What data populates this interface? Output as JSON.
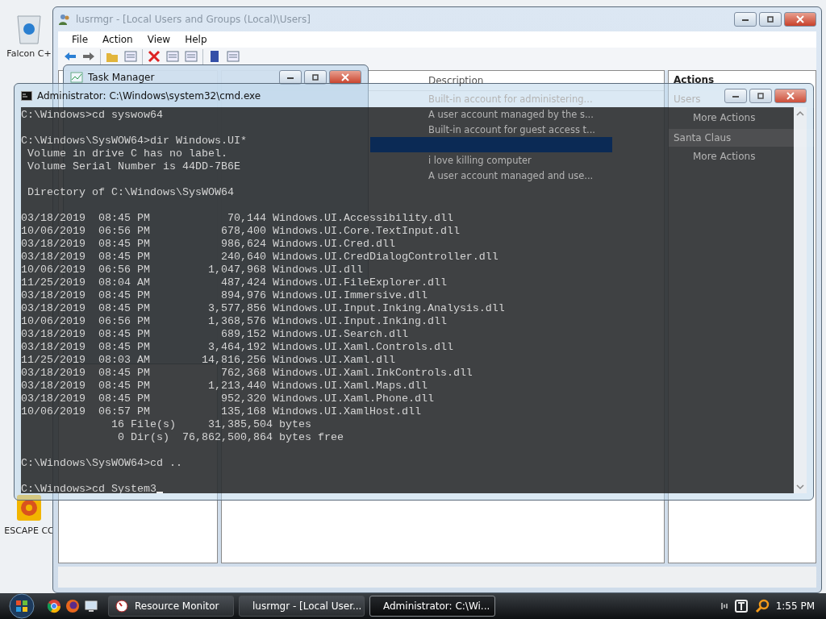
{
  "desktop_icons": [
    {
      "label": "Falcon C+"
    },
    {
      "label": "ESCAPE CC"
    }
  ],
  "lusrmgr": {
    "title": "lusrmgr - [Local Users and Groups (Local)\\Users]",
    "menu": [
      "File",
      "Action",
      "View",
      "Help"
    ],
    "description_header": "Description",
    "rows": [
      {
        "description": "Built-in account for administering...",
        "selected": false
      },
      {
        "description": "A user account managed by the s...",
        "selected": false
      },
      {
        "description": "Built-in account for guest access t...",
        "selected": false
      },
      {
        "selected": true
      },
      {
        "description": "i love killing computer",
        "selected": false
      },
      {
        "description": "A user account managed and use...",
        "selected": false
      }
    ],
    "actions_header": "Actions",
    "action_groups": [
      {
        "title": "Users",
        "items": [
          "More Actions"
        ]
      },
      {
        "title": "Santa Claus",
        "items": [
          "More Actions"
        ]
      }
    ]
  },
  "task_manager": {
    "title": "Task Manager"
  },
  "cmd": {
    "title": "Administrator: C:\\Windows\\system32\\cmd.exe",
    "blocks": [
      [
        "C:\\Windows>cd syswow64"
      ],
      [
        "C:\\Windows\\SysWOW64>dir Windows.UI*",
        " Volume in drive C has no label.",
        " Volume Serial Number is 44DD-7B6E"
      ],
      [
        " Directory of C:\\Windows\\SysWOW64"
      ],
      [
        "03/18/2019  08:45 PM            70,144 Windows.UI.Accessibility.dll",
        "10/06/2019  06:56 PM           678,400 Windows.UI.Core.TextInput.dll",
        "03/18/2019  08:45 PM           986,624 Windows.UI.Cred.dll",
        "03/18/2019  08:45 PM           240,640 Windows.UI.CredDialogController.dll",
        "10/06/2019  06:56 PM         1,047,968 Windows.UI.dll",
        "11/25/2019  08:04 AM           487,424 Windows.UI.FileExplorer.dll",
        "03/18/2019  08:45 PM           894,976 Windows.UI.Immersive.dll",
        "03/18/2019  08:45 PM         3,577,856 Windows.UI.Input.Inking.Analysis.dll",
        "10/06/2019  06:56 PM         1,368,576 Windows.UI.Input.Inking.dll",
        "03/18/2019  08:45 PM           689,152 Windows.UI.Search.dll",
        "03/18/2019  08:45 PM         3,464,192 Windows.UI.Xaml.Controls.dll",
        "11/25/2019  08:03 AM        14,816,256 Windows.UI.Xaml.dll",
        "03/18/2019  08:45 PM           762,368 Windows.UI.Xaml.InkControls.dll",
        "03/18/2019  08:45 PM         1,213,440 Windows.UI.Xaml.Maps.dll",
        "03/18/2019  08:45 PM           952,320 Windows.UI.Xaml.Phone.dll",
        "10/06/2019  06:57 PM           135,168 Windows.UI.XamlHost.dll",
        "              16 File(s)     31,385,504 bytes",
        "               0 Dir(s)  76,862,500,864 bytes free"
      ],
      [
        "C:\\Windows\\SysWOW64>cd .."
      ],
      [
        "C:\\Windows>cd System3"
      ]
    ]
  },
  "taskbar": {
    "buttons": [
      {
        "label": "Resource Monitor",
        "selected": false
      },
      {
        "label": "lusrmgr - [Local User...",
        "selected": false
      },
      {
        "label": "Administrator: C:\\Wi...",
        "selected": true
      }
    ],
    "clock": "1:55 PM"
  }
}
